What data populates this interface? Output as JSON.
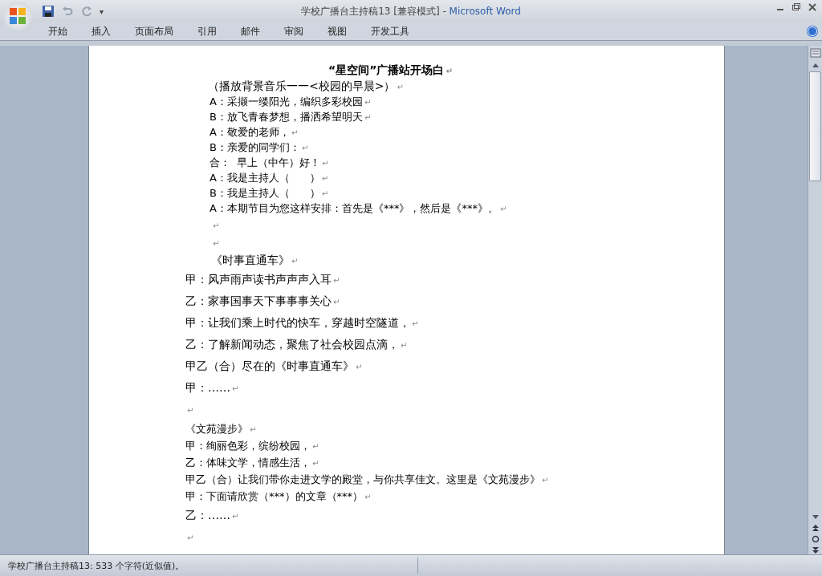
{
  "window": {
    "title_doc": "学校广播台主持稿13 [兼容模式]",
    "title_sep": " - ",
    "title_app": "Microsoft Word"
  },
  "quick_access": {
    "customize": "▾"
  },
  "tabs": [
    {
      "label": "开始",
      "selected": false
    },
    {
      "label": "插入",
      "selected": false
    },
    {
      "label": "页面布局",
      "selected": false
    },
    {
      "label": "引用",
      "selected": false
    },
    {
      "label": "邮件",
      "selected": false
    },
    {
      "label": "审阅",
      "selected": false
    },
    {
      "label": "视图",
      "selected": false
    },
    {
      "label": "开发工具",
      "selected": false
    }
  ],
  "document": {
    "paragraphs": [
      {
        "kind": "title",
        "text": "“星空间”广播站开场白",
        "mark": "↵"
      },
      {
        "kind": "lead",
        "text": "（播放背景音乐一一<校园的早晨>）",
        "mark": "↵"
      },
      {
        "kind": "indented",
        "text": "A：采撷一缕阳光，编织多彩校园",
        "mark": "↵"
      },
      {
        "kind": "indented",
        "text": "B：放飞青春梦想，播洒希望明天",
        "mark": "↵"
      },
      {
        "kind": "indented",
        "text": "A：敬爱的老师，",
        "mark": "↵"
      },
      {
        "kind": "indented",
        "text": "B：亲爱的同学们：",
        "mark": "↵"
      },
      {
        "kind": "indented",
        "text": "合：  早上（中午）好！",
        "mark": "↵"
      },
      {
        "kind": "indented",
        "text": "A：我是主持人（      ）",
        "mark": "↵"
      },
      {
        "kind": "indented",
        "text": "B：我是主持人（      ）",
        "mark": "↵"
      },
      {
        "kind": "indented",
        "text": "A：本期节目为您这样安排：首先是《***》，然后是《***》。",
        "mark": "↵"
      },
      {
        "kind": "indented-gap",
        "mark": "↵"
      },
      {
        "kind": "indented-gap",
        "mark": "↵"
      },
      {
        "kind": "indented-gap",
        "text": "《时事直通车》",
        "mark": "↵"
      },
      {
        "kind": "wide",
        "text": "甲：风声雨声读书声声声入耳",
        "mark": "↵"
      },
      {
        "kind": "wide",
        "text": "乙：家事国事天下事事事关心",
        "mark": "↵"
      },
      {
        "kind": "wide",
        "text": "甲：让我们乘上时代的快车，穿越时空隧道，",
        "mark": "↵"
      },
      {
        "kind": "wide",
        "text": "乙：了解新闻动态，聚焦了社会校园点滴，",
        "mark": "↵"
      },
      {
        "kind": "wide",
        "text": "甲乙（合）尽在的《时事直通车》",
        "mark": "↵"
      },
      {
        "kind": "wide",
        "text": "甲：……",
        "mark": "↵"
      },
      {
        "kind": "wide",
        "mark": "↵"
      },
      {
        "kind": "compact",
        "text": "《文苑漫步》",
        "mark": "↵"
      },
      {
        "kind": "compact",
        "text": "甲：绚丽色彩，缤纷校园，",
        "mark": "↵"
      },
      {
        "kind": "compact",
        "text": "乙：体味文学，情感生活，",
        "mark": "↵"
      },
      {
        "kind": "compact",
        "text": "甲乙（合）让我们带你走进文学的殿堂，与你共享佳文。这里是《文苑漫步》",
        "mark": "↵"
      },
      {
        "kind": "compact",
        "text": "甲：下面请欣赏（***）的文章（***）",
        "mark": "↵"
      },
      {
        "kind": "wide",
        "text": "乙：……",
        "mark": "↵"
      },
      {
        "kind": "wide",
        "mark": "↵"
      }
    ]
  },
  "status_bar": {
    "text": "学校广播台主持稿13: 533 个字符(近似值)。"
  }
}
